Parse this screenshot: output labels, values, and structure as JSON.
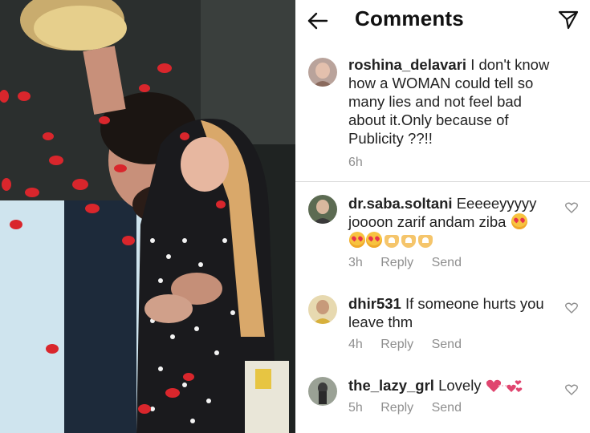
{
  "header": {
    "title": "Comments",
    "back_icon": "arrow-left-icon",
    "share_icon": "paper-plane-icon"
  },
  "caption": {
    "username": "roshina_delavari",
    "text": "I don't know how a WOMAN  could tell so many lies and not feel bad about it.Only because of Publicity ??!!",
    "time": "6h"
  },
  "comments": [
    {
      "username": "dr.saba.soltani",
      "text": "Eeeeeyyyyy joooon zarif andam ziba",
      "time": "3h",
      "reply_label": "Reply",
      "send_label": "Send",
      "emoji": "heart-eyes-and-heart-hands"
    },
    {
      "username": "dhir531",
      "text": "If someone hurts you leave thm",
      "time": "4h",
      "reply_label": "Reply",
      "send_label": "Send"
    },
    {
      "username": "the_lazy_grl",
      "text": "Lovely",
      "time": "5h",
      "reply_label": "Reply",
      "send_label": "Send",
      "emoji": "pink-hearts"
    }
  ],
  "colors": {
    "text": "#222222",
    "muted": "#8e8e8e",
    "divider": "#dbdbdb"
  }
}
